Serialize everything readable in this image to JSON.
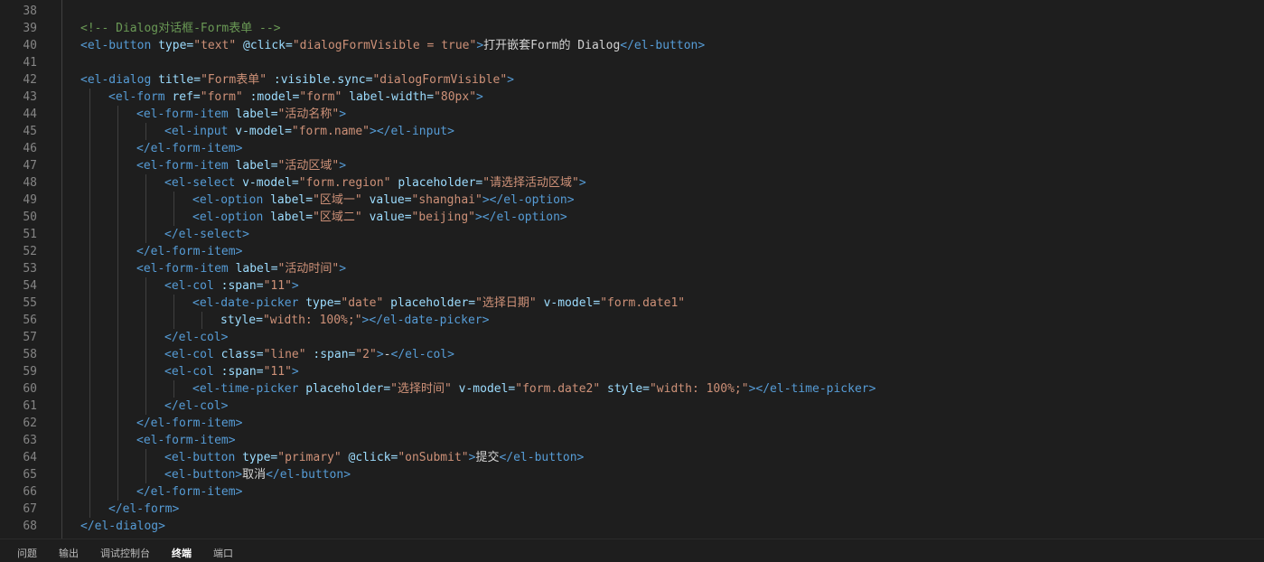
{
  "editor": {
    "lines": [
      {
        "n": "38",
        "indent": 1,
        "tokens": []
      },
      {
        "n": "39",
        "indent": 1,
        "tokens": [
          [
            "comment",
            "<!-- Dialog对话框-Form表单 -->"
          ]
        ]
      },
      {
        "n": "40",
        "indent": 1,
        "tokens": [
          [
            "tag",
            "<el-button"
          ],
          [
            "text",
            " "
          ],
          [
            "attr",
            "type="
          ],
          [
            "str",
            "\"text\""
          ],
          [
            "text",
            " "
          ],
          [
            "attr",
            "@click="
          ],
          [
            "str",
            "\"dialogFormVisible = true\""
          ],
          [
            "tag",
            ">"
          ],
          [
            "text",
            "打开嵌套Form的 Dialog"
          ],
          [
            "tag",
            "</el-button>"
          ]
        ]
      },
      {
        "n": "41",
        "indent": 1,
        "tokens": []
      },
      {
        "n": "42",
        "indent": 1,
        "tokens": [
          [
            "tag",
            "<el-dialog"
          ],
          [
            "text",
            " "
          ],
          [
            "attr",
            "title="
          ],
          [
            "str",
            "\"Form表单\""
          ],
          [
            "text",
            " "
          ],
          [
            "attr",
            ":visible.sync="
          ],
          [
            "str",
            "\"dialogFormVisible\""
          ],
          [
            "tag",
            ">"
          ]
        ]
      },
      {
        "n": "43",
        "indent": 2,
        "tokens": [
          [
            "tag",
            "<el-form"
          ],
          [
            "text",
            " "
          ],
          [
            "attr",
            "ref="
          ],
          [
            "str",
            "\"form\""
          ],
          [
            "text",
            " "
          ],
          [
            "attr",
            ":model="
          ],
          [
            "str",
            "\"form\""
          ],
          [
            "text",
            " "
          ],
          [
            "attr",
            "label-width="
          ],
          [
            "str",
            "\"80px\""
          ],
          [
            "tag",
            ">"
          ]
        ]
      },
      {
        "n": "44",
        "indent": 3,
        "tokens": [
          [
            "tag",
            "<el-form-item"
          ],
          [
            "text",
            " "
          ],
          [
            "attr",
            "label="
          ],
          [
            "str",
            "\"活动名称\""
          ],
          [
            "tag",
            ">"
          ]
        ]
      },
      {
        "n": "45",
        "indent": 4,
        "tokens": [
          [
            "tag",
            "<el-input"
          ],
          [
            "text",
            " "
          ],
          [
            "attr",
            "v-model="
          ],
          [
            "str",
            "\"form.name\""
          ],
          [
            "tag",
            "></el-input>"
          ]
        ]
      },
      {
        "n": "46",
        "indent": 3,
        "tokens": [
          [
            "tag",
            "</el-form-item>"
          ]
        ]
      },
      {
        "n": "47",
        "indent": 3,
        "tokens": [
          [
            "tag",
            "<el-form-item"
          ],
          [
            "text",
            " "
          ],
          [
            "attr",
            "label="
          ],
          [
            "str",
            "\"活动区域\""
          ],
          [
            "tag",
            ">"
          ]
        ]
      },
      {
        "n": "48",
        "indent": 4,
        "tokens": [
          [
            "tag",
            "<el-select"
          ],
          [
            "text",
            " "
          ],
          [
            "attr",
            "v-model="
          ],
          [
            "str",
            "\"form.region\""
          ],
          [
            "text",
            " "
          ],
          [
            "attr",
            "placeholder="
          ],
          [
            "str",
            "\"请选择活动区域\""
          ],
          [
            "tag",
            ">"
          ]
        ]
      },
      {
        "n": "49",
        "indent": 5,
        "tokens": [
          [
            "tag",
            "<el-option"
          ],
          [
            "text",
            " "
          ],
          [
            "attr",
            "label="
          ],
          [
            "str",
            "\"区域一\""
          ],
          [
            "text",
            " "
          ],
          [
            "attr",
            "value="
          ],
          [
            "str",
            "\"shanghai\""
          ],
          [
            "tag",
            "></el-option>"
          ]
        ]
      },
      {
        "n": "50",
        "indent": 5,
        "tokens": [
          [
            "tag",
            "<el-option"
          ],
          [
            "text",
            " "
          ],
          [
            "attr",
            "label="
          ],
          [
            "str",
            "\"区域二\""
          ],
          [
            "text",
            " "
          ],
          [
            "attr",
            "value="
          ],
          [
            "str",
            "\"beijing\""
          ],
          [
            "tag",
            "></el-option>"
          ]
        ]
      },
      {
        "n": "51",
        "indent": 4,
        "tokens": [
          [
            "tag",
            "</el-select>"
          ]
        ]
      },
      {
        "n": "52",
        "indent": 3,
        "tokens": [
          [
            "tag",
            "</el-form-item>"
          ]
        ]
      },
      {
        "n": "53",
        "indent": 3,
        "tokens": [
          [
            "tag",
            "<el-form-item"
          ],
          [
            "text",
            " "
          ],
          [
            "attr",
            "label="
          ],
          [
            "str",
            "\"活动时间\""
          ],
          [
            "tag",
            ">"
          ]
        ]
      },
      {
        "n": "54",
        "indent": 4,
        "tokens": [
          [
            "tag",
            "<el-col"
          ],
          [
            "text",
            " "
          ],
          [
            "attr",
            ":span="
          ],
          [
            "str",
            "\"11\""
          ],
          [
            "tag",
            ">"
          ]
        ]
      },
      {
        "n": "55",
        "indent": 5,
        "tokens": [
          [
            "tag",
            "<el-date-picker"
          ],
          [
            "text",
            " "
          ],
          [
            "attr",
            "type="
          ],
          [
            "str",
            "\"date\""
          ],
          [
            "text",
            " "
          ],
          [
            "attr",
            "placeholder="
          ],
          [
            "str",
            "\"选择日期\""
          ],
          [
            "text",
            " "
          ],
          [
            "attr",
            "v-model="
          ],
          [
            "str",
            "\"form.date1\""
          ]
        ]
      },
      {
        "n": "56",
        "indent": 6,
        "tokens": [
          [
            "attr",
            "style="
          ],
          [
            "str",
            "\"width: 100%;\""
          ],
          [
            "tag",
            "></el-date-picker>"
          ]
        ]
      },
      {
        "n": "57",
        "indent": 4,
        "tokens": [
          [
            "tag",
            "</el-col>"
          ]
        ]
      },
      {
        "n": "58",
        "indent": 4,
        "tokens": [
          [
            "tag",
            "<el-col"
          ],
          [
            "text",
            " "
          ],
          [
            "attr",
            "class="
          ],
          [
            "str",
            "\"line\""
          ],
          [
            "text",
            " "
          ],
          [
            "attr",
            ":span="
          ],
          [
            "str",
            "\"2\""
          ],
          [
            "tag",
            ">"
          ],
          [
            "text",
            "-"
          ],
          [
            "tag",
            "</el-col>"
          ]
        ]
      },
      {
        "n": "59",
        "indent": 4,
        "tokens": [
          [
            "tag",
            "<el-col"
          ],
          [
            "text",
            " "
          ],
          [
            "attr",
            ":span="
          ],
          [
            "str",
            "\"11\""
          ],
          [
            "tag",
            ">"
          ]
        ]
      },
      {
        "n": "60",
        "indent": 5,
        "tokens": [
          [
            "tag",
            "<el-time-picker"
          ],
          [
            "text",
            " "
          ],
          [
            "attr",
            "placeholder="
          ],
          [
            "str",
            "\"选择时间\""
          ],
          [
            "text",
            " "
          ],
          [
            "attr",
            "v-model="
          ],
          [
            "str",
            "\"form.date2\""
          ],
          [
            "text",
            " "
          ],
          [
            "attr",
            "style="
          ],
          [
            "str",
            "\"width: 100%;\""
          ],
          [
            "tag",
            "></el-time-picker>"
          ]
        ]
      },
      {
        "n": "61",
        "indent": 4,
        "tokens": [
          [
            "tag",
            "</el-col>"
          ]
        ]
      },
      {
        "n": "62",
        "indent": 3,
        "tokens": [
          [
            "tag",
            "</el-form-item>"
          ]
        ]
      },
      {
        "n": "63",
        "indent": 3,
        "tokens": [
          [
            "tag",
            "<el-form-item>"
          ]
        ]
      },
      {
        "n": "64",
        "indent": 4,
        "tokens": [
          [
            "tag",
            "<el-button"
          ],
          [
            "text",
            " "
          ],
          [
            "attr",
            "type="
          ],
          [
            "str",
            "\"primary\""
          ],
          [
            "text",
            " "
          ],
          [
            "attr",
            "@click="
          ],
          [
            "str",
            "\"onSubmit\""
          ],
          [
            "tag",
            ">"
          ],
          [
            "text",
            "提交"
          ],
          [
            "tag",
            "</el-button>"
          ]
        ]
      },
      {
        "n": "65",
        "indent": 4,
        "tokens": [
          [
            "tag",
            "<el-button>"
          ],
          [
            "text",
            "取消"
          ],
          [
            "tag",
            "</el-button>"
          ]
        ]
      },
      {
        "n": "66",
        "indent": 3,
        "tokens": [
          [
            "tag",
            "</el-form-item>"
          ]
        ]
      },
      {
        "n": "67",
        "indent": 2,
        "tokens": [
          [
            "tag",
            "</el-form>"
          ]
        ]
      },
      {
        "n": "68",
        "indent": 1,
        "tokens": [
          [
            "tag",
            "</el-dialog>"
          ]
        ]
      }
    ]
  },
  "panel": {
    "tabs": [
      {
        "label": "问题",
        "active": false
      },
      {
        "label": "输出",
        "active": false
      },
      {
        "label": "调试控制台",
        "active": false
      },
      {
        "label": "终端",
        "active": true
      },
      {
        "label": "端口",
        "active": false
      }
    ]
  },
  "colors": {
    "background": "#1e1e1e",
    "tag": "#569cd6",
    "attribute": "#9cdcfe",
    "string": "#ce9178",
    "comment": "#6a9955",
    "text": "#d4d4d4",
    "line_number": "#858585"
  }
}
